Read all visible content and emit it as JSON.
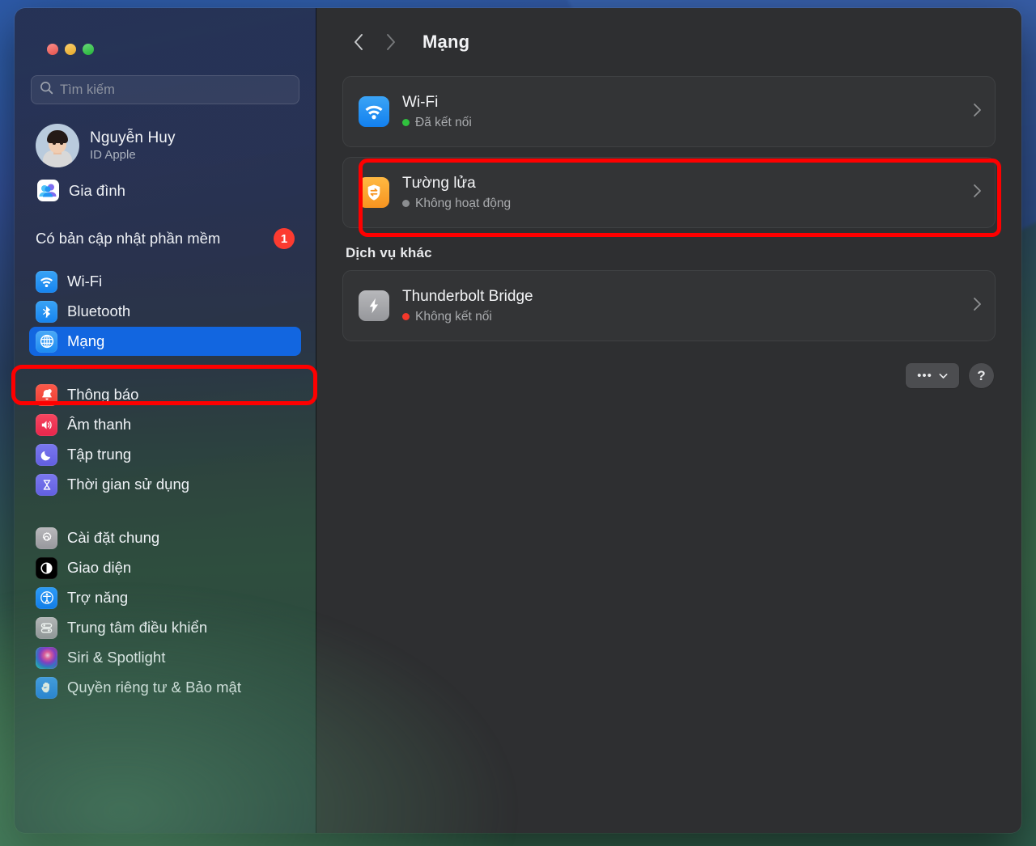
{
  "window": {
    "traffic_lights": [
      {
        "name": "close",
        "color": "#fc5d57"
      },
      {
        "name": "minimize",
        "color": "#fdbc2f"
      },
      {
        "name": "maximize",
        "color": "#28c93f"
      }
    ]
  },
  "sidebar": {
    "search": {
      "placeholder": "Tìm kiếm",
      "value": "",
      "icon": "search-icon"
    },
    "account": {
      "name": "Nguyễn Huy",
      "subtitle": "ID Apple"
    },
    "family": {
      "label": "Gia đình",
      "icon": "family-icon"
    },
    "software_update": {
      "label": "Có bản cập nhật phần mềm",
      "badge": "1",
      "badge_color": "#fc3b30"
    },
    "groups": [
      {
        "items": [
          {
            "label": "Wi-Fi",
            "icon": "wifi-icon",
            "selected": false
          },
          {
            "label": "Bluetooth",
            "icon": "bluetooth-icon",
            "selected": false
          },
          {
            "label": "Mạng",
            "icon": "globe-icon",
            "selected": true
          }
        ]
      },
      {
        "items": [
          {
            "label": "Thông báo",
            "icon": "bell-icon",
            "selected": false
          },
          {
            "label": "Âm thanh",
            "icon": "speaker-icon",
            "selected": false
          },
          {
            "label": "Tập trung",
            "icon": "moon-icon",
            "selected": false
          },
          {
            "label": "Thời gian sử dụng",
            "icon": "hourglass-icon",
            "selected": false
          }
        ]
      },
      {
        "items": [
          {
            "label": "Cài đặt chung",
            "icon": "gear-icon",
            "selected": false
          },
          {
            "label": "Giao diện",
            "icon": "appearance-icon",
            "selected": false
          },
          {
            "label": "Trợ năng",
            "icon": "accessibility-icon",
            "selected": false
          },
          {
            "label": "Trung tâm điều khiển",
            "icon": "control-center-icon",
            "selected": false
          },
          {
            "label": "Siri & Spotlight",
            "icon": "siri-icon",
            "selected": false
          },
          {
            "label": "Quyền riêng tư & Bảo mật",
            "icon": "privacy-hand-icon",
            "selected": false
          }
        ]
      }
    ],
    "selection_color": "#1266e0"
  },
  "content": {
    "toolbar": {
      "back_icon": "chevron-left-icon",
      "forward_icon": "chevron-right-icon",
      "title": "Mạng"
    },
    "primary_services": [
      {
        "name": "Wi-Fi",
        "status": "Đã kết nối",
        "status_color": "#30c13e",
        "icon": "wifi-icon",
        "chevron": "chevron-right-icon"
      },
      {
        "name": "Tường lửa",
        "status": "Không hoạt động",
        "status_color": "#8b8d90",
        "icon": "firewall-shield-icon",
        "chevron": "chevron-right-icon",
        "highlighted": true
      }
    ],
    "other_section": {
      "heading": "Dịch vụ khác",
      "services": [
        {
          "name": "Thunderbolt Bridge",
          "status": "Không kết nối",
          "status_color": "#f4382b",
          "icon": "thunderbolt-icon",
          "chevron": "chevron-right-icon"
        }
      ]
    },
    "footer": {
      "more_label": "•••",
      "more_icon": "chevron-down-icon",
      "help_label": "?"
    }
  },
  "annotations": [
    {
      "name": "sidebar-mang-highlight",
      "color": "#fe0000"
    },
    {
      "name": "firewall-row-highlight",
      "color": "#fe0000"
    }
  ]
}
